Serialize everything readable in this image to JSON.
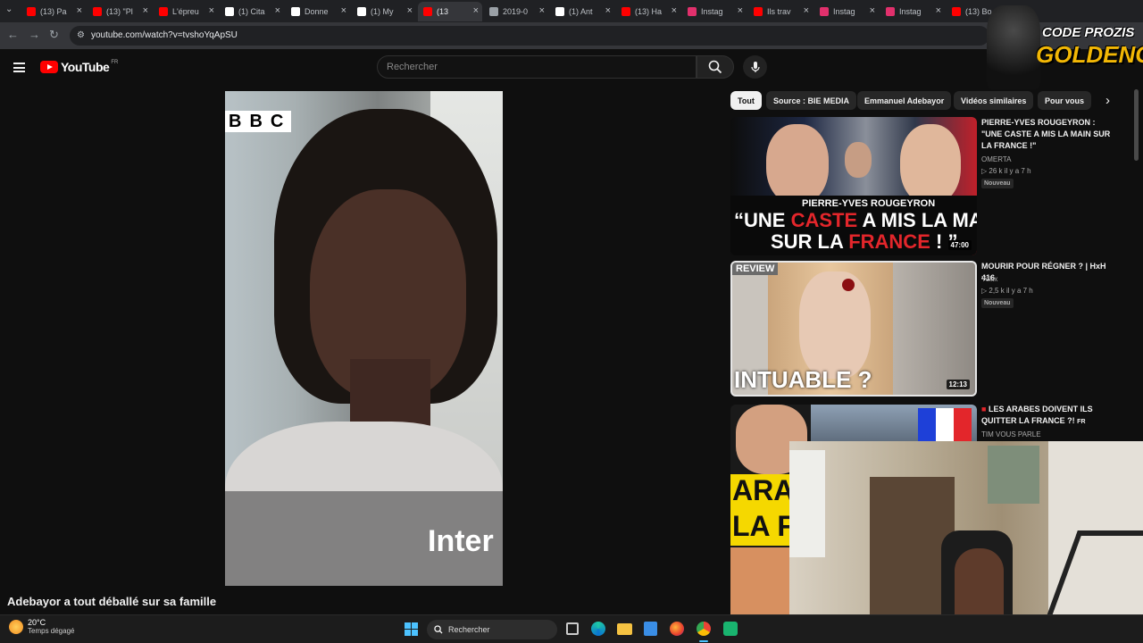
{
  "tabs": [
    {
      "label": "(13) Pa",
      "color": "#ff0000"
    },
    {
      "label": "(13) \"Pl",
      "color": "#ff0000"
    },
    {
      "label": "L'épreu",
      "color": "#ff0000"
    },
    {
      "label": "(1) Cita",
      "color": "#ffffff"
    },
    {
      "label": "Donne",
      "color": "#ffffff"
    },
    {
      "label": "(1) My",
      "color": "#ffffff"
    },
    {
      "label": "(13",
      "color": "#ff0000"
    },
    {
      "label": "2019-0",
      "color": "#9aa0a6"
    },
    {
      "label": "(1) Ant",
      "color": "#ffffff"
    },
    {
      "label": "(13) Ha",
      "color": "#ff0000"
    },
    {
      "label": "Instag",
      "color": "#e1306c"
    },
    {
      "label": "Ils trav",
      "color": "#ff0000"
    },
    {
      "label": "Instag",
      "color": "#e1306c"
    },
    {
      "label": "Instag",
      "color": "#e1306c"
    },
    {
      "label": "(13) Bo",
      "color": "#ff0000"
    }
  ],
  "address": {
    "url": "youtube.com/watch?v=tvshoYqApSU"
  },
  "youtube": {
    "logo_text": "YouTube",
    "region": "FR",
    "search_placeholder": "Rechercher"
  },
  "video": {
    "watermark": "BBC",
    "caption": "Inter",
    "title": "Adebayor a tout déballé sur sa famille"
  },
  "chips": [
    "Tout",
    "Source : BIE MEDIA",
    "Emmanuel Adebayor",
    "Vidéos similaires",
    "Pour vous"
  ],
  "recommendations": [
    {
      "title": "PIERRE-YVES ROUGEYRON : \"UNE CASTE A MIS LA MAIN SUR LA FRANCE !\"",
      "channel": "OMERTA",
      "meta": "▷ 26 k  il y a 7 h",
      "badge": "Nouveau",
      "duration": "47:00",
      "thumb_name": "PIERRE-YVES ROUGEYRON",
      "thumb_line1": "“UNE",
      "thumb_red": "CASTE",
      "thumb_line1b": "A MIS LA MAIN",
      "thumb_line2": "SUR LA",
      "thumb_red2": "FRANCE",
      "thumb_line2b": "! ”"
    },
    {
      "title": "MOURIR POUR RÉGNER ? | HxH 416",
      "channel": "Yollix",
      "meta": "▷ 2,5 k  il y a 7 h",
      "badge": "Nouveau",
      "duration": "12:13",
      "thumb_tag": "REVIEW",
      "thumb_text": "INTUABLE ?"
    },
    {
      "title": "LES ARABES DOIVENT ILS QUITTER LA FRANCE ?!",
      "title_suffix": "FR",
      "channel": "TIM VOUS PARLE",
      "thumb_text1": "ARA",
      "thumb_text2": "LA F"
    }
  ],
  "overlay": {
    "line1": "CODE PROZIS",
    "line2": "GOLDENG"
  },
  "taskbar": {
    "temperature": "20°C",
    "weather": "Temps dégagé",
    "search_placeholder": "Rechercher"
  },
  "colors": {
    "brand_red": "#ff0000",
    "gold": "#f2b705",
    "bg": "#0f0f0f"
  }
}
